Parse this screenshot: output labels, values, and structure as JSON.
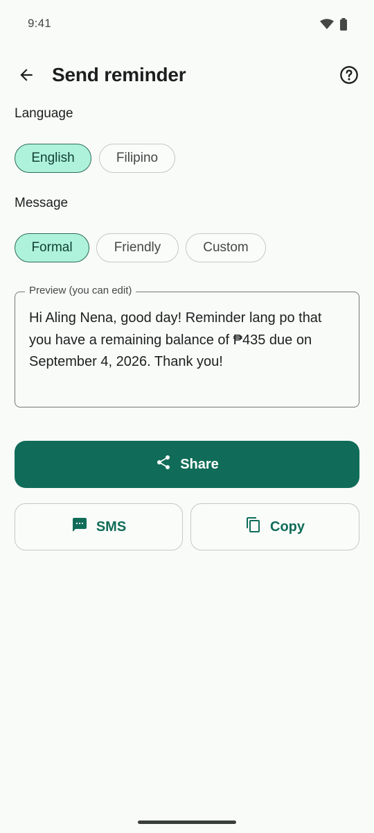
{
  "status_bar": {
    "time": "9:41",
    "wifi_icon": "wifi-icon",
    "battery_icon": "battery-icon"
  },
  "app_bar": {
    "title": "Send reminder",
    "back_icon": "arrow-back-icon",
    "help_icon": "help-circle-icon"
  },
  "language": {
    "label": "Language",
    "options": [
      {
        "label": "English",
        "selected": true
      },
      {
        "label": "Filipino",
        "selected": false
      }
    ]
  },
  "message": {
    "label": "Message",
    "options": [
      {
        "label": "Formal",
        "selected": true
      },
      {
        "label": "Friendly",
        "selected": false
      },
      {
        "label": "Custom",
        "selected": false
      }
    ]
  },
  "preview": {
    "label": "Preview (you can edit)",
    "text": "Hi Aling Nena, good day! Reminder lang po that you have a remaining balance of ₱435 due on September 4, 2026. Thank you!"
  },
  "actions": {
    "share_label": "Share",
    "sms_label": "SMS",
    "copy_label": "Copy"
  },
  "colors": {
    "primary": "#106C58",
    "chip_selected_bg": "#AEF2DC",
    "background": "#F9FBF9"
  }
}
